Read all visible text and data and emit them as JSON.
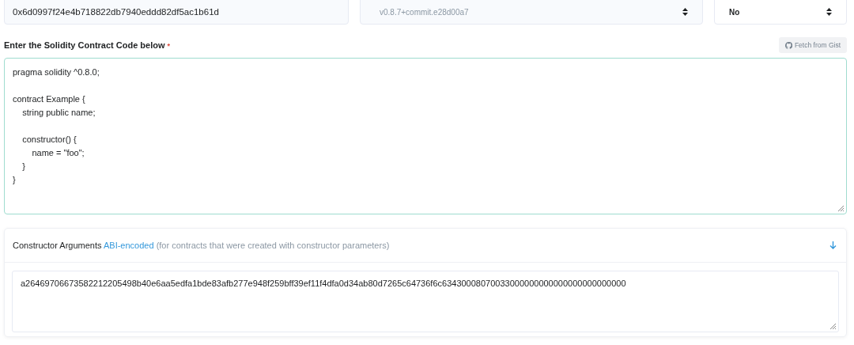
{
  "address_field": {
    "value": "0x6d0997f24e4b718822db7940eddd82df5ac1b61d"
  },
  "compiler_select": {
    "value": "v0.8.7+commit.e28d00a7",
    "disabled": true
  },
  "optimization_select": {
    "value": "No",
    "disabled": false
  },
  "code_section": {
    "label": "Enter the Solidity Contract Code below",
    "required_mark": "*",
    "fetch_button": "Fetch from Gist",
    "code": "pragma solidity ^0.8.0;\n\ncontract Example {\n    string public name;\n\n    constructor() {\n        name = \"foo\";\n    }\n}"
  },
  "constructor_arguments": {
    "title": "Constructor Arguments",
    "link": "ABI-encoded",
    "note": "(for contracts that were created with constructor parameters)",
    "expanded": true,
    "value": "a26469706673582212205498b40e6aa5edfa1bde83afb277e948f259bff39ef11f4dfa0d34ab80d7265c64736f6c63430008070033000000000000000000000000"
  }
}
